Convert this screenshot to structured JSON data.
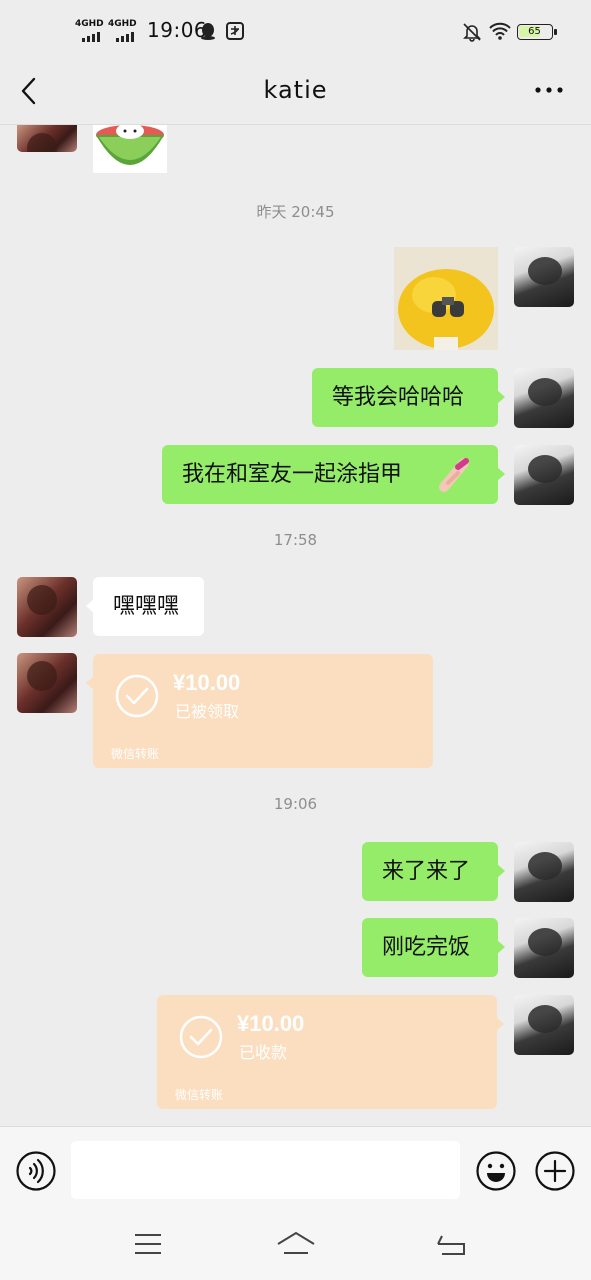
{
  "status_bar": {
    "network1": "4GHD",
    "network2": "4GHD",
    "time": "19:06",
    "battery": "65"
  },
  "header": {
    "title": "katie"
  },
  "messages": {
    "ts1": "昨天 20:45",
    "m1": "等我会哈哈哈",
    "m2": "我在和室友一起涂指甲",
    "ts2": "17:58",
    "m3": "嘿嘿嘿",
    "transfer1": {
      "amount": "¥10.00",
      "status": "已被领取",
      "footer": "微信转账"
    },
    "ts3": "19:06",
    "m4": "来了来了",
    "m5": "刚吃完饭",
    "transfer2": {
      "amount": "¥10.00",
      "status": "已收款",
      "footer": "微信转账"
    }
  },
  "icons": {
    "voice": "voice-icon",
    "emoji": "emoji-icon",
    "plus": "plus-icon",
    "back": "back-icon",
    "more": "more-icon"
  },
  "colors": {
    "sent_bubble": "#95ec69",
    "received_bubble": "#ffffff",
    "transfer": "#fbdec0",
    "background": "#ededed"
  }
}
